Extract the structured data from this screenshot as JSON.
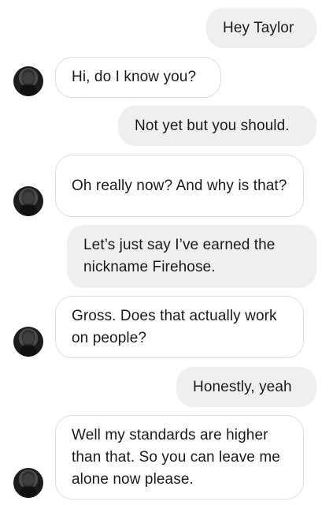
{
  "contact": {
    "avatar_icon": "profile-photo-avatar"
  },
  "messages": [
    {
      "from": "me",
      "text": "Hey Taylor"
    },
    {
      "from": "them",
      "text": "Hi, do I know you?"
    },
    {
      "from": "me",
      "text": "Not yet but you should."
    },
    {
      "from": "them",
      "text": "Oh really now? And why is that?"
    },
    {
      "from": "me",
      "text": "Let’s just say I’ve earned the nickname Firehose."
    },
    {
      "from": "them",
      "text": "Gross. Does that actually work on people?"
    },
    {
      "from": "me",
      "text": "Honestly, yeah"
    },
    {
      "from": "them",
      "text": "Well my standards are higher than that. So you can leave me alone now please."
    }
  ],
  "colors": {
    "outgoing_bubble": "#efefef",
    "incoming_border": "#dcdcdc",
    "background": "#ffffff"
  }
}
